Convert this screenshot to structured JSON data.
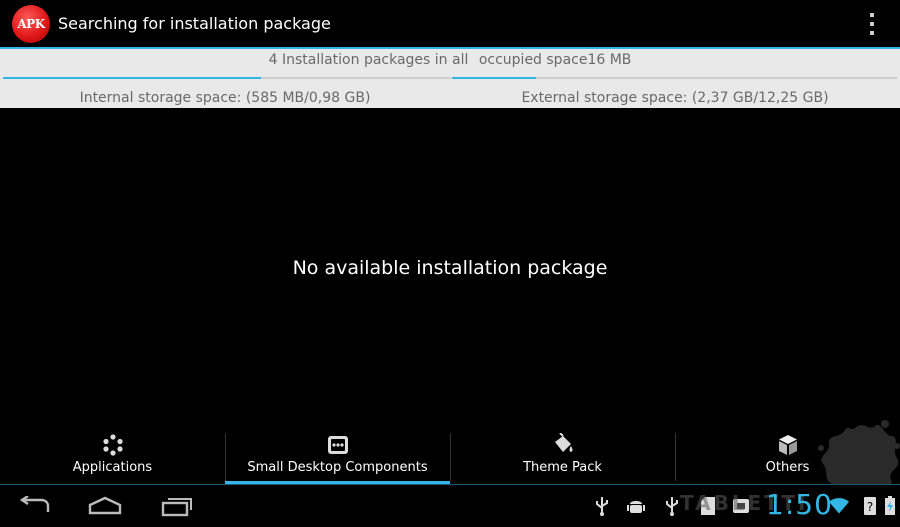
{
  "app": {
    "logo_text": "APK",
    "title": "Searching for installation package"
  },
  "summary": {
    "packages": "4 Installation packages in all",
    "occupied": "occupied space16 MB"
  },
  "storage": {
    "internal": "Internal storage space: (585 MB/0,98 GB)",
    "external": "External storage space: (2,37 GB/12,25 GB)",
    "internal_fill": 0.58,
    "external_fill": 0.19
  },
  "empty_message": "No available installation package",
  "tabs": [
    {
      "label": "Applications",
      "icon": "applications-icon"
    },
    {
      "label": "Small Desktop Components",
      "icon": "widget-icon",
      "selected": true
    },
    {
      "label": "Theme Pack",
      "icon": "paint-bucket-icon"
    },
    {
      "label": "Others",
      "icon": "box-icon"
    }
  ],
  "system_bar": {
    "clock": "1:50",
    "watermark": "TABLETTI",
    "accent": "#33b5e5"
  }
}
